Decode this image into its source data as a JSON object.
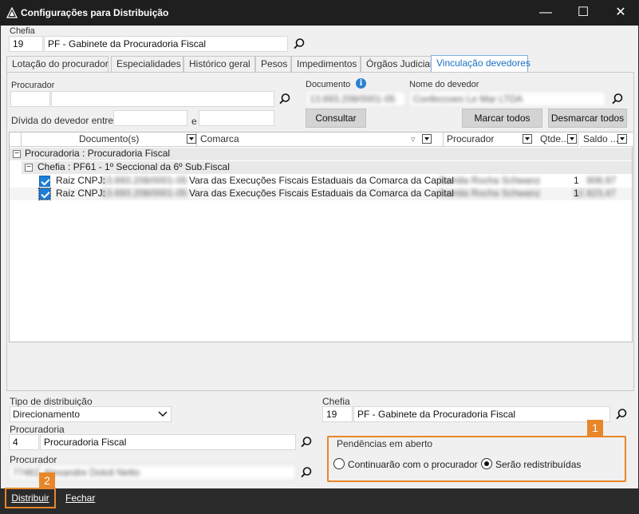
{
  "window": {
    "title": "Configurações para Distribuição",
    "minimize": "—",
    "maximize": "☐",
    "close": "✕"
  },
  "chefia_top": {
    "label": "Chefia",
    "code": "19",
    "name": "PF - Gabinete da Procuradoria Fiscal"
  },
  "tabs": [
    {
      "label": "Lotação do procurador",
      "active": false
    },
    {
      "label": "Especialidades",
      "active": false
    },
    {
      "label": "Histórico geral",
      "active": false
    },
    {
      "label": "Pesos",
      "active": false
    },
    {
      "label": "Impedimentos",
      "active": false
    },
    {
      "label": "Órgãos Judiciais",
      "active": false
    },
    {
      "label": "Vinculação devedores",
      "active": true
    }
  ],
  "filters": {
    "procurador_label": "Procurador",
    "procurador_code": "",
    "procurador_name": "",
    "documento_label": "Documento",
    "documento_value": "13.693.208/0001-05",
    "nome_devedor_label": "Nome do devedor",
    "nome_devedor_value": "Confeccoes Le Mar LTDA",
    "divida_label": "Dívida do devedor entre",
    "divida_from": "",
    "divida_and": "e",
    "divida_to": "",
    "consultar": "Consultar",
    "marcar_todos": "Marcar todos",
    "desmarcar_todos": "Desmarcar todos"
  },
  "grid": {
    "columns": [
      "Documento(s)",
      "Comarca",
      "Procurador",
      "Qtde...",
      "Saldo ..."
    ],
    "group1": "Procuradoria : Procuradoria Fiscal",
    "group2": "Chefia : PF61 - 1º Seccional da 6º Sub.Fiscal",
    "rows": [
      {
        "doc_prefix": "Raiz CNPJ:",
        "doc": "13.693.208/0001-05",
        "comarca": "Vara das Execuções Fiscais Estaduais da Comarca da Capital",
        "procurador": "Camila Rocha Schwanz",
        "qtde": "1",
        "saldo": "908,97"
      },
      {
        "doc_prefix": "Raiz CNPJ:",
        "doc": "13.693.208/0001-05",
        "comarca": "Vara das Execuções Fiscais Estaduais da Comarca da Capital",
        "procurador": "Camila Rocha Schwanz",
        "qtde": "1",
        "saldo": "12.823,47"
      }
    ]
  },
  "distribution": {
    "tipo_label": "Tipo de distribuição",
    "tipo_value": "Direcionamento",
    "procuradoria_label": "Procuradoria",
    "procuradoria_code": "4",
    "procuradoria_name": "Procuradoria Fiscal",
    "procurador_label": "Procurador",
    "procurador_code": "77481",
    "procurador_name": "Alexandre Dotoli Netto",
    "chefia_label": "Chefia",
    "chefia_code": "19",
    "chefia_name": "PF - Gabinete da Procuradoria Fiscal"
  },
  "pendencias": {
    "label": "Pendências em aberto",
    "opt1": "Continuarão com o procurador",
    "opt2": "Serão redistribuídas",
    "selected": "opt2"
  },
  "badges": {
    "b1": "1",
    "b2": "2"
  },
  "footer": {
    "distribuir": "Distribuir",
    "fechar": "Fechar"
  },
  "colors": {
    "accent": "#e8862a",
    "tab_active": "#1a6fc2",
    "check": "#1e7fd8"
  }
}
